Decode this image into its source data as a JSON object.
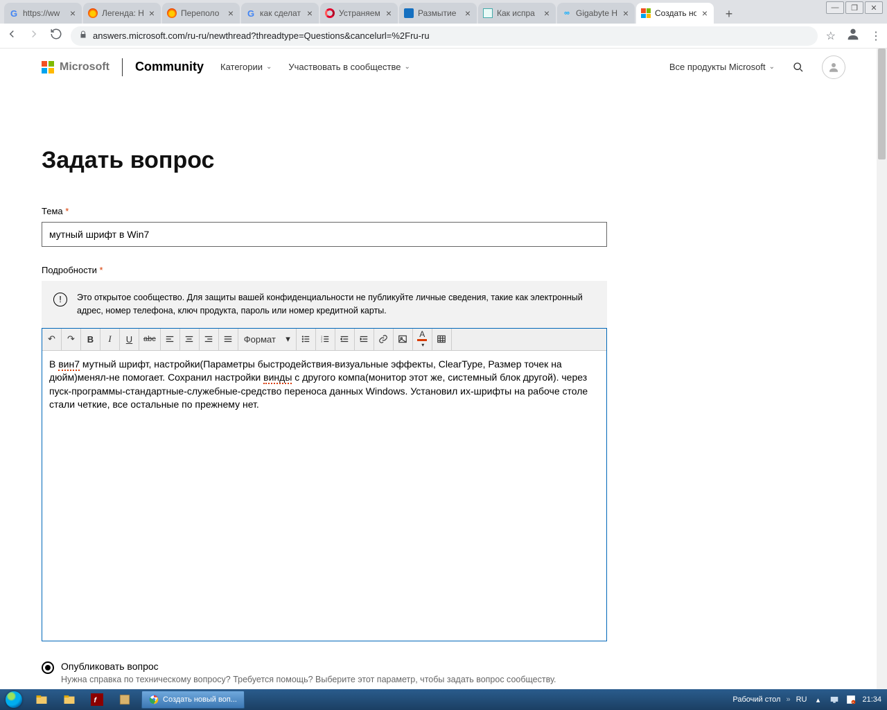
{
  "browser": {
    "tabs": [
      {
        "title": "https://ww",
        "fav": "g"
      },
      {
        "title": "Легенда: Н",
        "fav": "fire"
      },
      {
        "title": "Переполо",
        "fav": "fire"
      },
      {
        "title": "как сделат",
        "fav": "g"
      },
      {
        "title": "Устраняем",
        "fav": "opera"
      },
      {
        "title": "Размытие",
        "fav": "blue"
      },
      {
        "title": "Как испра",
        "fav": "sq"
      },
      {
        "title": "Gigabyte H",
        "fav": "gb"
      },
      {
        "title": "Создать но",
        "fav": "ms"
      }
    ],
    "url": "answers.microsoft.com/ru-ru/newthread?threadtype=Questions&cancelurl=%2Fru-ru"
  },
  "header": {
    "brand": "Microsoft",
    "community": "Community",
    "menu": {
      "categories": "Категории",
      "participate": "Участвовать в сообществе"
    },
    "products": "Все продукты Microsoft"
  },
  "page": {
    "title": "Задать вопрос",
    "topic_label": "Тема",
    "topic_value": "мутный шрифт в Win7",
    "details_label": "Подробности",
    "notice": "Это открытое сообщество. Для защиты вашей конфиденциальности не публикуйте личные сведения, такие как электронный адрес, номер телефона, ключ продукта, пароль или номер кредитной карты.",
    "format_label": "Формат",
    "body_parts": {
      "p1a": "В ",
      "p1a_spell": "вин7",
      "p1b": " мутный шрифт, настройки(Параметры быстродействия-визуальные эффекты, ClearType, Размер точек на дюйм)менял-не помогает. Сохранил настройки ",
      "p1b_spell": "винды",
      "p1c": " с другого компа(монитор этот же, системный блок другой). через пуск-программы-стандартные-служебные-средство переноса данных Windows. Установил их-шрифты на рабоче столе стали четкие, все остальные по прежнему нет."
    },
    "publish_label": "Опубликовать вопрос",
    "publish_sub": "Нужна справка по техническому вопросу? Требуется помощь? Выберите этот параметр, чтобы задать вопрос сообществу."
  },
  "taskbar": {
    "running": "Создать новый воп...",
    "desktop": "Рабочий стол",
    "lang": "RU",
    "time": "21:34"
  }
}
